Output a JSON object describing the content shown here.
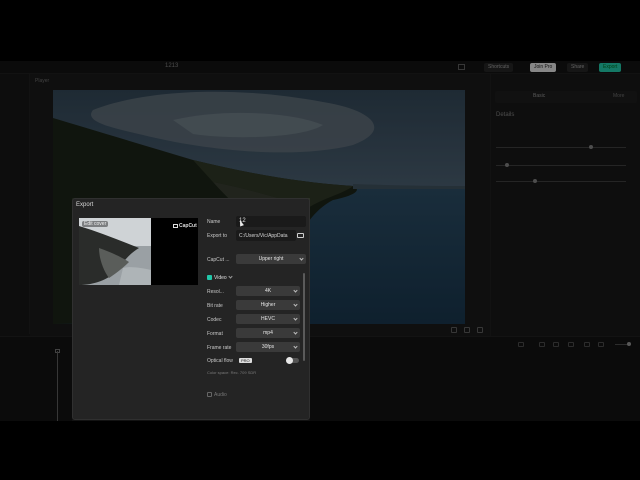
{
  "app": {
    "title": "1213"
  },
  "topbar": {
    "shortcuts_label": "Shortcuts",
    "join_pro_label": "Join Pro",
    "share_label": "Share",
    "export_label": "Export"
  },
  "player": {
    "label": "Player"
  },
  "right_panel": {
    "tab_basic": "Basic",
    "tab_more": "More",
    "details_heading": "Details"
  },
  "export_dialog": {
    "title": "Export",
    "edit_cover_label": "Edit cover",
    "watermark_text": "CapCut",
    "name_label": "Name",
    "name_value": "12",
    "export_to_label": "Export to",
    "export_to_value": "C:/Users/Vic/AppData",
    "watermark_label": "CapCut ...",
    "watermark_position": "Upper right",
    "video_section": "Video",
    "resolution_label": "Resol...",
    "resolution_value": "4K",
    "bitrate_label": "Bit rate",
    "bitrate_value": "Higher",
    "codec_label": "Codec",
    "codec_value": "HEVC",
    "format_label": "Format",
    "format_value": "mp4",
    "frame_rate_label": "Frame rate",
    "frame_rate_value": "30fps",
    "optical_flow_label": "Optical flow",
    "pro_badge": "PRO",
    "color_space_hint": "Color space: Rec. 709 SDR",
    "audio_section": "Audio"
  },
  "colors": {
    "accent": "#22c7a9",
    "join_pro_bg": "#cfcfcf",
    "export_btn_bg": "#1fb89c"
  }
}
